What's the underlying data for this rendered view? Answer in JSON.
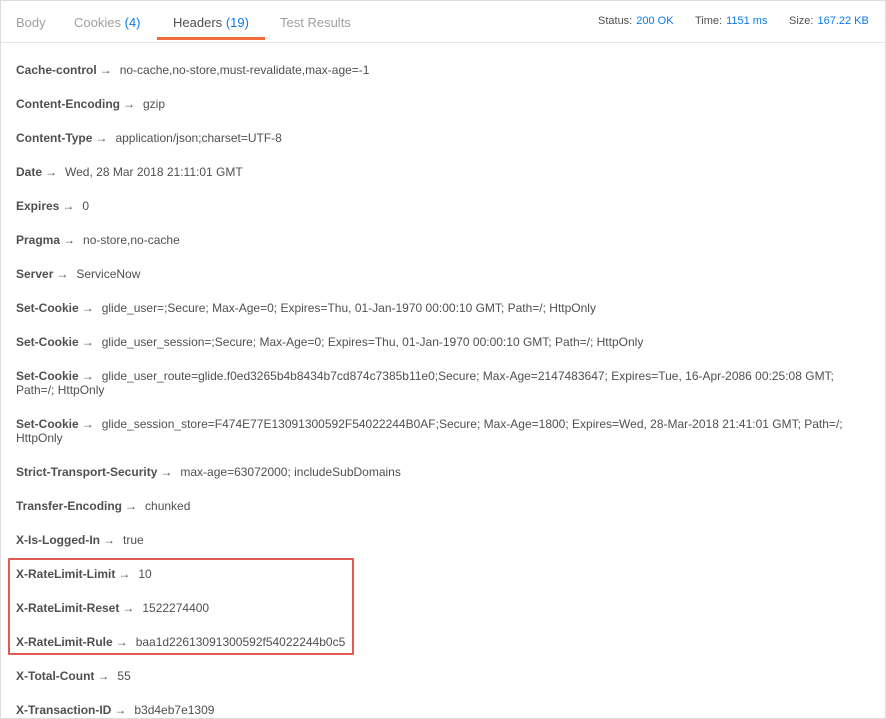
{
  "tabs": {
    "body": {
      "label": "Body"
    },
    "cookies": {
      "label": "Cookies",
      "count": "(4)"
    },
    "headers": {
      "label": "Headers",
      "count": "(19)"
    },
    "tests": {
      "label": "Test Results"
    }
  },
  "meta": {
    "status_label": "Status:",
    "status_value": "200 OK",
    "time_label": "Time:",
    "time_value": "1151 ms",
    "size_label": "Size:",
    "size_value": "167.22 KB"
  },
  "arrow": "→",
  "headers": [
    {
      "key": "Cache-control",
      "value": "no-cache,no-store,must-revalidate,max-age=-1"
    },
    {
      "key": "Content-Encoding",
      "value": "gzip"
    },
    {
      "key": "Content-Type",
      "value": "application/json;charset=UTF-8"
    },
    {
      "key": "Date",
      "value": "Wed, 28 Mar 2018 21:11:01 GMT"
    },
    {
      "key": "Expires",
      "value": "0"
    },
    {
      "key": "Pragma",
      "value": "no-store,no-cache"
    },
    {
      "key": "Server",
      "value": "ServiceNow"
    },
    {
      "key": "Set-Cookie",
      "value": "glide_user=;Secure; Max-Age=0; Expires=Thu, 01-Jan-1970 00:00:10 GMT; Path=/; HttpOnly"
    },
    {
      "key": "Set-Cookie",
      "value": "glide_user_session=;Secure; Max-Age=0; Expires=Thu, 01-Jan-1970 00:00:10 GMT; Path=/; HttpOnly"
    },
    {
      "key": "Set-Cookie",
      "value": "glide_user_route=glide.f0ed3265b4b8434b7cd874c7385b11e0;Secure; Max-Age=2147483647; Expires=Tue, 16-Apr-2086 00:25:08 GMT; Path=/; HttpOnly"
    },
    {
      "key": "Set-Cookie",
      "value": "glide_session_store=F474E77E13091300592F54022244B0AF;Secure; Max-Age=1800; Expires=Wed, 28-Mar-2018 21:41:01 GMT; Path=/; HttpOnly"
    },
    {
      "key": "Strict-Transport-Security",
      "value": "max-age=63072000; includeSubDomains"
    },
    {
      "key": "Transfer-Encoding",
      "value": "chunked"
    },
    {
      "key": "X-Is-Logged-In",
      "value": "true"
    },
    {
      "key": "X-RateLimit-Limit",
      "value": "10"
    },
    {
      "key": "X-RateLimit-Reset",
      "value": "1522274400"
    },
    {
      "key": "X-RateLimit-Rule",
      "value": "baa1d22613091300592f54022244b0c5"
    },
    {
      "key": "X-Total-Count",
      "value": "55"
    },
    {
      "key": "X-Transaction-ID",
      "value": "b3d4eb7e1309"
    }
  ],
  "highlight_color": "#e05a4f",
  "accent_color": "#f26b3a",
  "link_color": "#097bed"
}
